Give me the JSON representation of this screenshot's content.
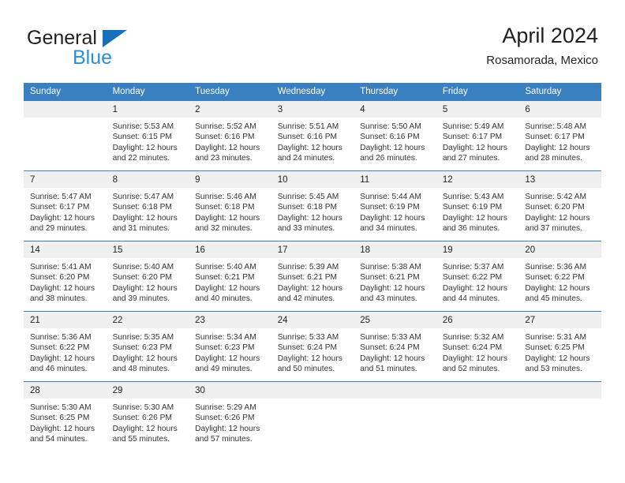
{
  "logo": {
    "word1": "General",
    "word2": "Blue",
    "triangle_icon": "triangle-icon",
    "blue": "#2b8fd4",
    "triangle_color": "#1a70b8"
  },
  "header": {
    "title": "April 2024",
    "location": "Rosamorada, Mexico"
  },
  "colors": {
    "header_band": "#3a7fc0",
    "date_strip": "#f0f0f0",
    "separator": "#3a7fc0",
    "text": "#231f20"
  },
  "calendar": {
    "weekday_headers": [
      "Sunday",
      "Monday",
      "Tuesday",
      "Wednesday",
      "Thursday",
      "Friday",
      "Saturday"
    ],
    "weeks": [
      [
        {
          "date": "",
          "empty": true,
          "sunrise": "",
          "sunset": "",
          "daylight_line1": "",
          "daylight_line2": ""
        },
        {
          "date": "1",
          "sunrise": "Sunrise: 5:53 AM",
          "sunset": "Sunset: 6:15 PM",
          "daylight_line1": "Daylight: 12 hours",
          "daylight_line2": "and 22 minutes."
        },
        {
          "date": "2",
          "sunrise": "Sunrise: 5:52 AM",
          "sunset": "Sunset: 6:16 PM",
          "daylight_line1": "Daylight: 12 hours",
          "daylight_line2": "and 23 minutes."
        },
        {
          "date": "3",
          "sunrise": "Sunrise: 5:51 AM",
          "sunset": "Sunset: 6:16 PM",
          "daylight_line1": "Daylight: 12 hours",
          "daylight_line2": "and 24 minutes."
        },
        {
          "date": "4",
          "sunrise": "Sunrise: 5:50 AM",
          "sunset": "Sunset: 6:16 PM",
          "daylight_line1": "Daylight: 12 hours",
          "daylight_line2": "and 26 minutes."
        },
        {
          "date": "5",
          "sunrise": "Sunrise: 5:49 AM",
          "sunset": "Sunset: 6:17 PM",
          "daylight_line1": "Daylight: 12 hours",
          "daylight_line2": "and 27 minutes."
        },
        {
          "date": "6",
          "sunrise": "Sunrise: 5:48 AM",
          "sunset": "Sunset: 6:17 PM",
          "daylight_line1": "Daylight: 12 hours",
          "daylight_line2": "and 28 minutes."
        }
      ],
      [
        {
          "date": "7",
          "sunrise": "Sunrise: 5:47 AM",
          "sunset": "Sunset: 6:17 PM",
          "daylight_line1": "Daylight: 12 hours",
          "daylight_line2": "and 29 minutes."
        },
        {
          "date": "8",
          "sunrise": "Sunrise: 5:47 AM",
          "sunset": "Sunset: 6:18 PM",
          "daylight_line1": "Daylight: 12 hours",
          "daylight_line2": "and 31 minutes."
        },
        {
          "date": "9",
          "sunrise": "Sunrise: 5:46 AM",
          "sunset": "Sunset: 6:18 PM",
          "daylight_line1": "Daylight: 12 hours",
          "daylight_line2": "and 32 minutes."
        },
        {
          "date": "10",
          "sunrise": "Sunrise: 5:45 AM",
          "sunset": "Sunset: 6:18 PM",
          "daylight_line1": "Daylight: 12 hours",
          "daylight_line2": "and 33 minutes."
        },
        {
          "date": "11",
          "sunrise": "Sunrise: 5:44 AM",
          "sunset": "Sunset: 6:19 PM",
          "daylight_line1": "Daylight: 12 hours",
          "daylight_line2": "and 34 minutes."
        },
        {
          "date": "12",
          "sunrise": "Sunrise: 5:43 AM",
          "sunset": "Sunset: 6:19 PM",
          "daylight_line1": "Daylight: 12 hours",
          "daylight_line2": "and 36 minutes."
        },
        {
          "date": "13",
          "sunrise": "Sunrise: 5:42 AM",
          "sunset": "Sunset: 6:20 PM",
          "daylight_line1": "Daylight: 12 hours",
          "daylight_line2": "and 37 minutes."
        }
      ],
      [
        {
          "date": "14",
          "sunrise": "Sunrise: 5:41 AM",
          "sunset": "Sunset: 6:20 PM",
          "daylight_line1": "Daylight: 12 hours",
          "daylight_line2": "and 38 minutes."
        },
        {
          "date": "15",
          "sunrise": "Sunrise: 5:40 AM",
          "sunset": "Sunset: 6:20 PM",
          "daylight_line1": "Daylight: 12 hours",
          "daylight_line2": "and 39 minutes."
        },
        {
          "date": "16",
          "sunrise": "Sunrise: 5:40 AM",
          "sunset": "Sunset: 6:21 PM",
          "daylight_line1": "Daylight: 12 hours",
          "daylight_line2": "and 40 minutes."
        },
        {
          "date": "17",
          "sunrise": "Sunrise: 5:39 AM",
          "sunset": "Sunset: 6:21 PM",
          "daylight_line1": "Daylight: 12 hours",
          "daylight_line2": "and 42 minutes."
        },
        {
          "date": "18",
          "sunrise": "Sunrise: 5:38 AM",
          "sunset": "Sunset: 6:21 PM",
          "daylight_line1": "Daylight: 12 hours",
          "daylight_line2": "and 43 minutes."
        },
        {
          "date": "19",
          "sunrise": "Sunrise: 5:37 AM",
          "sunset": "Sunset: 6:22 PM",
          "daylight_line1": "Daylight: 12 hours",
          "daylight_line2": "and 44 minutes."
        },
        {
          "date": "20",
          "sunrise": "Sunrise: 5:36 AM",
          "sunset": "Sunset: 6:22 PM",
          "daylight_line1": "Daylight: 12 hours",
          "daylight_line2": "and 45 minutes."
        }
      ],
      [
        {
          "date": "21",
          "sunrise": "Sunrise: 5:36 AM",
          "sunset": "Sunset: 6:22 PM",
          "daylight_line1": "Daylight: 12 hours",
          "daylight_line2": "and 46 minutes."
        },
        {
          "date": "22",
          "sunrise": "Sunrise: 5:35 AM",
          "sunset": "Sunset: 6:23 PM",
          "daylight_line1": "Daylight: 12 hours",
          "daylight_line2": "and 48 minutes."
        },
        {
          "date": "23",
          "sunrise": "Sunrise: 5:34 AM",
          "sunset": "Sunset: 6:23 PM",
          "daylight_line1": "Daylight: 12 hours",
          "daylight_line2": "and 49 minutes."
        },
        {
          "date": "24",
          "sunrise": "Sunrise: 5:33 AM",
          "sunset": "Sunset: 6:24 PM",
          "daylight_line1": "Daylight: 12 hours",
          "daylight_line2": "and 50 minutes."
        },
        {
          "date": "25",
          "sunrise": "Sunrise: 5:33 AM",
          "sunset": "Sunset: 6:24 PM",
          "daylight_line1": "Daylight: 12 hours",
          "daylight_line2": "and 51 minutes."
        },
        {
          "date": "26",
          "sunrise": "Sunrise: 5:32 AM",
          "sunset": "Sunset: 6:24 PM",
          "daylight_line1": "Daylight: 12 hours",
          "daylight_line2": "and 52 minutes."
        },
        {
          "date": "27",
          "sunrise": "Sunrise: 5:31 AM",
          "sunset": "Sunset: 6:25 PM",
          "daylight_line1": "Daylight: 12 hours",
          "daylight_line2": "and 53 minutes."
        }
      ],
      [
        {
          "date": "28",
          "sunrise": "Sunrise: 5:30 AM",
          "sunset": "Sunset: 6:25 PM",
          "daylight_line1": "Daylight: 12 hours",
          "daylight_line2": "and 54 minutes."
        },
        {
          "date": "29",
          "sunrise": "Sunrise: 5:30 AM",
          "sunset": "Sunset: 6:26 PM",
          "daylight_line1": "Daylight: 12 hours",
          "daylight_line2": "and 55 minutes."
        },
        {
          "date": "30",
          "sunrise": "Sunrise: 5:29 AM",
          "sunset": "Sunset: 6:26 PM",
          "daylight_line1": "Daylight: 12 hours",
          "daylight_line2": "and 57 minutes."
        },
        {
          "date": "",
          "empty": true,
          "sunrise": "",
          "sunset": "",
          "daylight_line1": "",
          "daylight_line2": ""
        },
        {
          "date": "",
          "empty": true,
          "sunrise": "",
          "sunset": "",
          "daylight_line1": "",
          "daylight_line2": ""
        },
        {
          "date": "",
          "empty": true,
          "sunrise": "",
          "sunset": "",
          "daylight_line1": "",
          "daylight_line2": ""
        },
        {
          "date": "",
          "empty": true,
          "sunrise": "",
          "sunset": "",
          "daylight_line1": "",
          "daylight_line2": ""
        }
      ]
    ]
  }
}
